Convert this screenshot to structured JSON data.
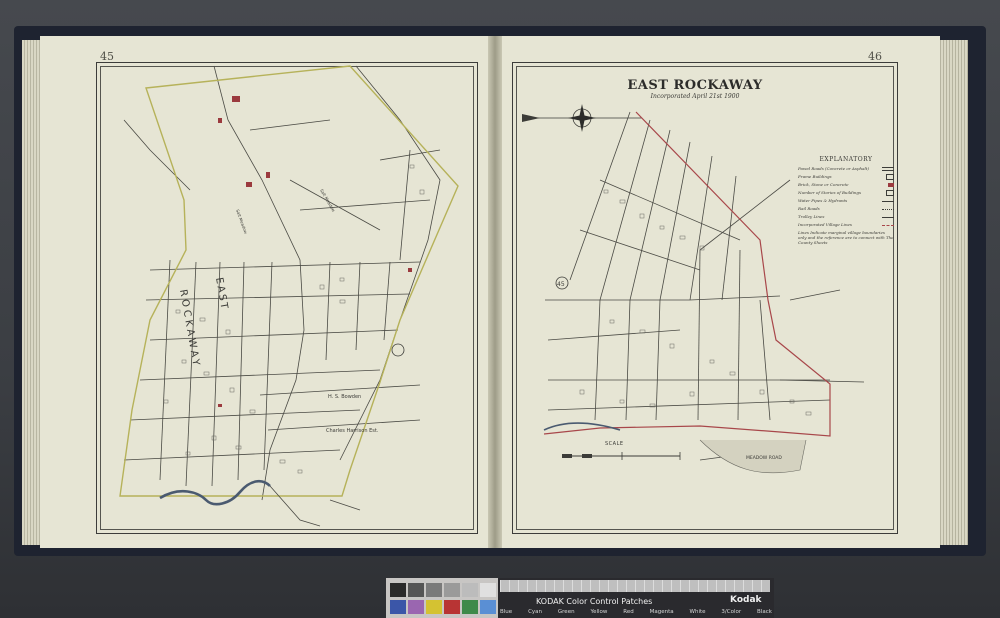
{
  "left_page": {
    "page_number": "45",
    "labels": {
      "vertical_east": "EAST",
      "vertical_rockaway": "ROCKAWAY",
      "marsh_1": "Salt Meadow",
      "marsh_2": "Salt Meadow",
      "street_1": "H. S. Bowden",
      "street_2": "Charles Harrison Est."
    }
  },
  "right_page": {
    "page_number": "46",
    "title": "EAST ROCKAWAY",
    "subtitle": "Incorporated April 21st 1900",
    "route_marker": "45",
    "legend": {
      "title": "EXPLANATORY",
      "items": [
        {
          "label": "Paved Roads (Concrete or Asphalt)",
          "symbol": "double-line"
        },
        {
          "label": "Frame Buildings",
          "symbol": "outline-box"
        },
        {
          "label": "Brick, Stone or Concrete",
          "symbol": "red-box"
        },
        {
          "label": "Number of Stories of Buildings",
          "symbol": "number-box"
        },
        {
          "label": "Water Pipes & Hydrants",
          "symbol": "line-dot"
        },
        {
          "label": "Rail Roads",
          "symbol": "rail-line"
        },
        {
          "label": "Trolley Lines",
          "symbol": "line"
        },
        {
          "label": "Incorporated Village Lines",
          "symbol": "dashed-line"
        }
      ],
      "note": "Lines Indicate marginal village boundaries only and the reference are to connect with The County Sheets"
    },
    "scale_label": "SCALE",
    "road_label": "MEADOW ROAD"
  },
  "color_target": {
    "title": "KODAK Color Control Patches",
    "brand": "Kodak",
    "patch_names": [
      "Blue",
      "Cyan",
      "Green",
      "Yellow",
      "Red",
      "Magenta",
      "White",
      "3/Color",
      "Black"
    ]
  },
  "colors": {
    "paper": "#e6e5d4",
    "ink": "#3c3c38",
    "boundary_yellow": "#b6b25a",
    "boundary_red": "#a8474a",
    "building_red": "#9b3a3e",
    "cover": "#1e2330"
  }
}
